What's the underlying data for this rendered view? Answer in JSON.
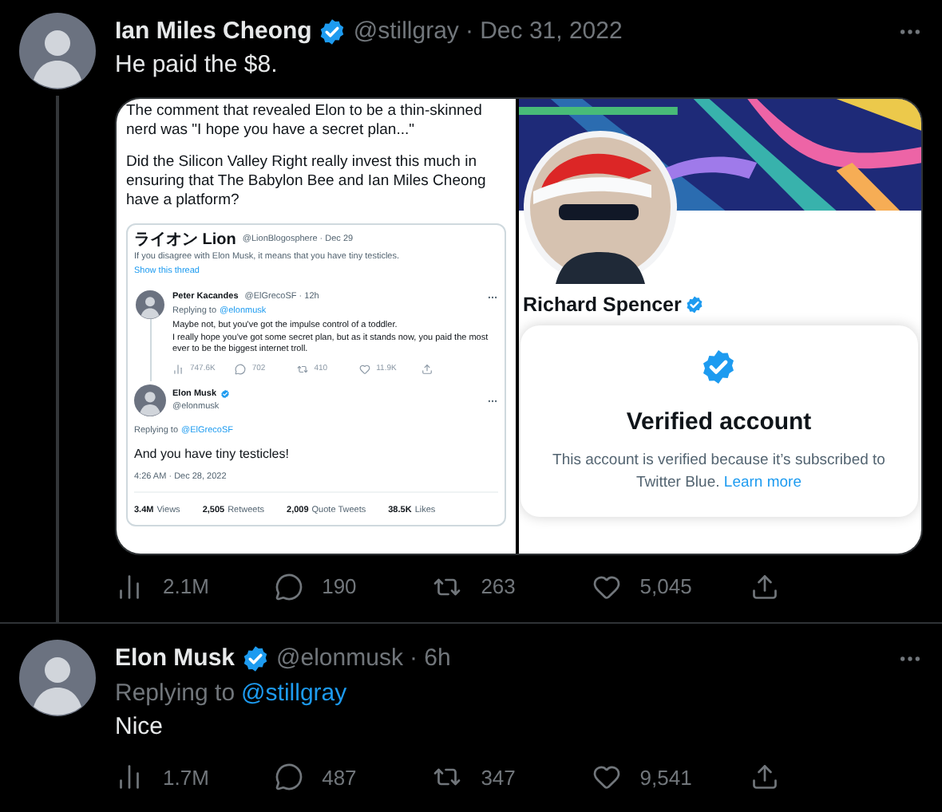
{
  "tweets": [
    {
      "name": "Ian Miles Cheong",
      "handle": "@stillgray",
      "date": "· Dec 31, 2022",
      "text": "He paid the $8.",
      "thread_line": true,
      "media": {
        "left": {
          "paragraphs": [
            "The comment that revealed Elon to be a thin-skinned nerd was \"I hope you have a secret plan...\"",
            "Did the Silicon Valley Right really invest this much in ensuring that The Babylon Bee and Ian Miles Cheong have a platform?"
          ],
          "quoted": {
            "name": "ライオン Lion",
            "handle": "@LionBlogosphere · Dec 29",
            "text": "If you disagree with Elon Musk, it means that you have tiny testicles.",
            "link": "Show this thread"
          },
          "reply": {
            "name": "Peter Kacandes",
            "handle": "@ElGrecoSF · 12h",
            "replying": "Replying to",
            "replying_handle": "@elonmusk",
            "lines": [
              "Maybe not, but you've got the impulse control of a toddler.",
              "I really hope you've got some secret plan, but as it stands now, you paid the most ever to be the biggest internet troll."
            ],
            "stats": [
              {
                "kind": "views",
                "value": "747.6K"
              },
              {
                "kind": "reply",
                "value": "702"
              },
              {
                "kind": "retweet",
                "value": "410"
              },
              {
                "kind": "like",
                "value": "11.9K"
              },
              {
                "kind": "share"
              }
            ]
          },
          "main": {
            "name": "Elon Musk",
            "handle": "@elonmusk",
            "replying": "Replying to",
            "replying_handle": "@ElGrecoSF",
            "text": "And you have tiny testicles!",
            "time": "4:26 AM · Dec 28, 2022",
            "totals": [
              {
                "value": "3.4M",
                "label": "Views"
              },
              {
                "value": "2,505",
                "label": "Retweets"
              },
              {
                "value": "2,009",
                "label": "Quote Tweets"
              },
              {
                "value": "38.5K",
                "label": "Likes"
              }
            ]
          }
        },
        "right": {
          "name": "Richard Spencer",
          "popup_title": "Verified account",
          "popup_text": "This account is verified because it’s subscribed to Twitter Blue.",
          "popup_link": "Learn more"
        }
      },
      "stats": [
        {
          "kind": "views",
          "value": "2.1M"
        },
        {
          "kind": "reply",
          "value": "190"
        },
        {
          "kind": "retweet",
          "value": "263"
        },
        {
          "kind": "like",
          "value": "5,045"
        },
        {
          "kind": "share"
        }
      ]
    },
    {
      "name": "Elon Musk",
      "handle": "@elonmusk",
      "date": "· 6h",
      "replying": "Replying to",
      "replying_handle": "@stillgray",
      "text": "Nice",
      "thread_line": false,
      "stats": [
        {
          "kind": "views",
          "value": "1.7M"
        },
        {
          "kind": "reply",
          "value": "487"
        },
        {
          "kind": "retweet",
          "value": "347"
        },
        {
          "kind": "like",
          "value": "9,541"
        },
        {
          "kind": "share"
        }
      ]
    }
  ]
}
